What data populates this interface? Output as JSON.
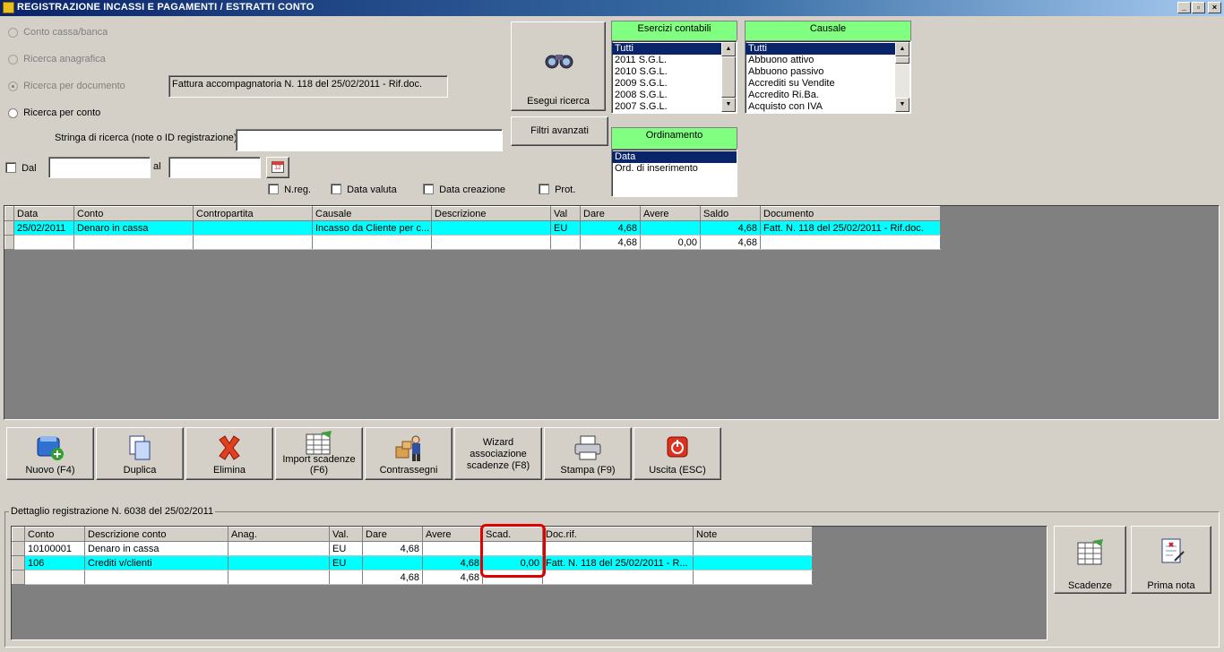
{
  "window": {
    "title": "REGISTRAZIONE INCASSI E PAGAMENTI / ESTRATTI CONTO",
    "minimize": "_",
    "restore": "▫",
    "close": "×"
  },
  "search": {
    "radio_conto_cassa": "Conto cassa/banca",
    "radio_anagrafica": "Ricerca anagrafica",
    "radio_documento": "Ricerca per documento",
    "radio_conto": "Ricerca per conto",
    "documento_value": "Fattura accompagnatoria N. 118 del 25/02/2011 - Rif.doc.",
    "stringa_label": "Stringa di ricerca (note o ID registrazione)",
    "stringa_value": "",
    "dal_label": "Dal",
    "al_label": "al",
    "dal_value": "",
    "al_value": "",
    "calendar_day": "12",
    "nreg_label": "N.reg.",
    "data_valuta_label": "Data valuta",
    "data_creazione_label": "Data creazione",
    "prot_label": "Prot.",
    "esegui_label": "Esegui ricerca",
    "filtri_label": "Filtri avanzati"
  },
  "esercizi": {
    "header": "Esercizi contabili",
    "items": [
      "Tutti",
      "2011 S.G.L.",
      "2010 S.G.L.",
      "2009 S.G.L.",
      "2008 S.G.L.",
      "2007 S.G.L."
    ],
    "selected": 0
  },
  "causale": {
    "header": "Causale",
    "items": [
      "Tutti",
      "Abbuono attivo",
      "Abbuono passivo",
      "Accrediti su Vendite",
      "Accredito Ri.Ba.",
      "Acquisto con IVA"
    ],
    "selected": 0
  },
  "ordinamento": {
    "header": "Ordinamento",
    "items": [
      "Data",
      "Ord. di inserimento"
    ],
    "selected": 0
  },
  "main_grid": {
    "columns": [
      "Data",
      "Conto",
      "Contropartita",
      "Causale",
      "Descrizione",
      "Val",
      "Dare",
      "Avere",
      "Saldo",
      "Documento"
    ],
    "rows": [
      [
        "25/02/2011",
        "Denaro in cassa",
        "",
        "Incasso da Cliente per c...",
        "",
        "EU",
        "4,68",
        "",
        "4,68",
        "Fatt. N. 118 del 25/02/2011 - Rif.doc."
      ],
      [
        "",
        "",
        "",
        "",
        "",
        "",
        "4,68",
        "0,00",
        "4,68",
        ""
      ]
    ]
  },
  "toolbar": {
    "nuovo": "Nuovo (F4)",
    "duplica": "Duplica",
    "elimina": "Elimina",
    "import": "Import scadenze (F6)",
    "contrassegni": "Contrassegni",
    "wizard": "Wizard associazione scadenze (F8)",
    "stampa": "Stampa (F9)",
    "uscita": "Uscita (ESC)"
  },
  "detail": {
    "legend": "Dettaglio registrazione N. 6038 del 25/02/2011",
    "columns": [
      "Conto",
      "Descrizione conto",
      "Anag.",
      "Val.",
      "Dare",
      "Avere",
      "Scad.",
      "Doc.rif.",
      "Note"
    ],
    "rows": [
      [
        "10100001",
        "Denaro in cassa",
        "",
        "EU",
        "4,68",
        "",
        "",
        "",
        ""
      ],
      [
        "106",
        "Crediti v/clienti",
        "",
        "EU",
        "",
        "4,68",
        "0,00",
        "Fatt. N. 118 del 25/02/2011 - R...",
        ""
      ],
      [
        "",
        "",
        "",
        "",
        "4,68",
        "4,68",
        "",
        "",
        ""
      ]
    ],
    "scadenze_label": "Scadenze",
    "prima_nota_label": "Prima nota"
  },
  "colors": {
    "highlight_row": "#00ffff",
    "list_header": "#80ff80",
    "selection": "#0a246a",
    "annotation_box": "#e00000"
  }
}
